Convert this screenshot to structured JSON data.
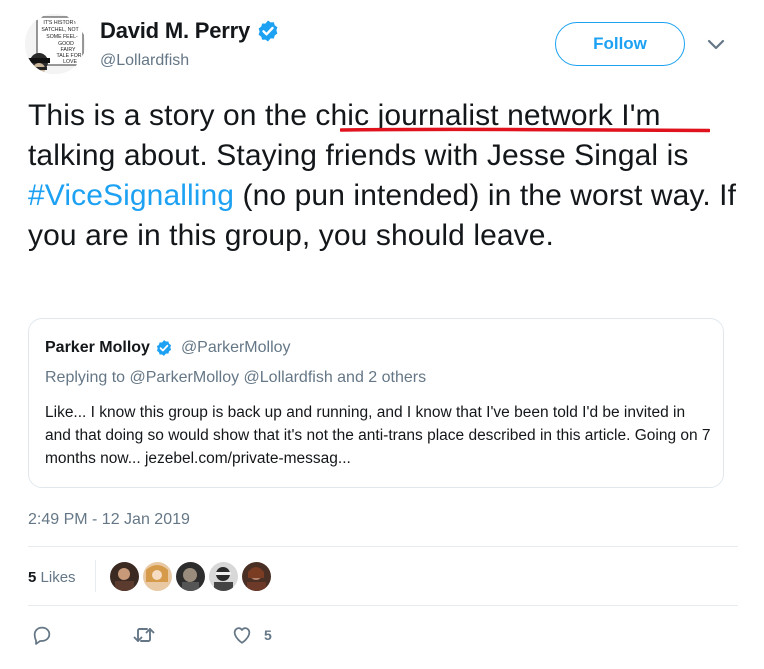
{
  "tweet": {
    "author_name": "David M. Perry",
    "handle": "@Lollardfish",
    "follow_label": "Follow",
    "text_plain_1": "This is a story on the ",
    "text_underlined": "chic journalist network ",
    "text_plain_2": "I'm talking about. Staying friends with Jesse Singal is ",
    "hashtag": "#ViceSignalling",
    "text_plain_3": " (no pun intended) in the worst way. If you are in this group, you should leave.",
    "timestamp": "2:49 PM - 12 Jan 2019",
    "likes_count": "5",
    "likes_label": "Likes",
    "like_action_count": "5"
  },
  "avatar_sign_text": [
    "IT'S HISTORY",
    "SATCHEL, NOT",
    "SOME FEEL-",
    "GOOD",
    "FAIRY",
    "TALE FOR",
    "LOVE"
  ],
  "quoted_tweet": {
    "author_name": "Parker Molloy",
    "handle": "@ParkerMolloy",
    "replying_to": "Replying to @ParkerMolloy @Lollardfish and 2 others",
    "text": "Like... I know this group is back up and running, and I know that I've been told I'd be invited in and that doing so would show that it's not the anti-trans place described in this article. Going on 7 months now... jezebel.com/private-messag..."
  },
  "icons": [
    "verified-badge-icon",
    "chevron-down-icon",
    "reply-icon",
    "retweet-icon",
    "heart-icon"
  ],
  "colors": {
    "accent": "#1da1f2",
    "text": "#14171a",
    "muted": "#657786",
    "border": "#e1e8ed",
    "annotation_red": "#e0121e"
  }
}
